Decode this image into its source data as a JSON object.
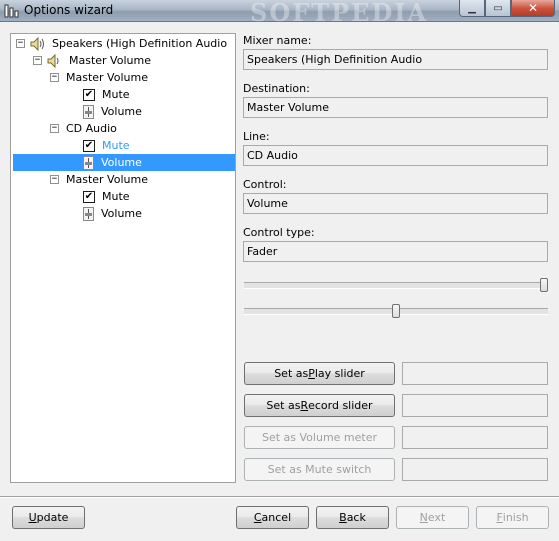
{
  "window": {
    "title": "Options wizard",
    "watermark": "SOFTPEDIA",
    "minimize_glyph": "▁",
    "maximize_glyph": "▭",
    "close_glyph": "✕"
  },
  "tree": {
    "root": "Speakers (High Definition Audio",
    "master": "Master Volume",
    "group1": "Master Volume",
    "group1_mute": "Mute",
    "group1_volume": "Volume",
    "group2": "CD Audio",
    "group2_mute": "Mute",
    "group2_volume": "Volume",
    "group3": "Master Volume",
    "group3_mute": "Mute",
    "group3_volume": "Volume",
    "collapse_glyph": "−",
    "check_glyph": "✔",
    "icons": [
      "speaker-icon",
      "fader-icon",
      "checkbox-icon"
    ]
  },
  "details": {
    "mixer_label": "Mixer name:",
    "mixer_value": "Speakers (High Definition Audio",
    "destination_label": "Destination:",
    "destination_value": "Master Volume",
    "line_label": "Line:",
    "line_value": "CD Audio",
    "control_label": "Control:",
    "control_value": "Volume",
    "control_type_label": "Control type:",
    "control_type_value": "Fader"
  },
  "sliders": {
    "slider1_level": 1.0,
    "slider2_level": 0.5
  },
  "actions": {
    "play_pre": "Set as ",
    "play_key": "P",
    "play_post": "lay slider",
    "record_pre": "Set as ",
    "record_key": "R",
    "record_post": "ecord slider",
    "meter_label": "Set as Volume meter",
    "mute_label": "Set as Mute switch"
  },
  "footer": {
    "update_key": "U",
    "update_rest": "pdate",
    "cancel_pre": "",
    "cancel_key": "C",
    "cancel_rest": "ancel",
    "back_key": "B",
    "back_rest": "ack",
    "next_key": "N",
    "next_rest": "ext",
    "finish_key": "F",
    "finish_rest": "inish"
  },
  "colors": {
    "selection": "#3399ff",
    "hover_text": "#3399ff"
  }
}
